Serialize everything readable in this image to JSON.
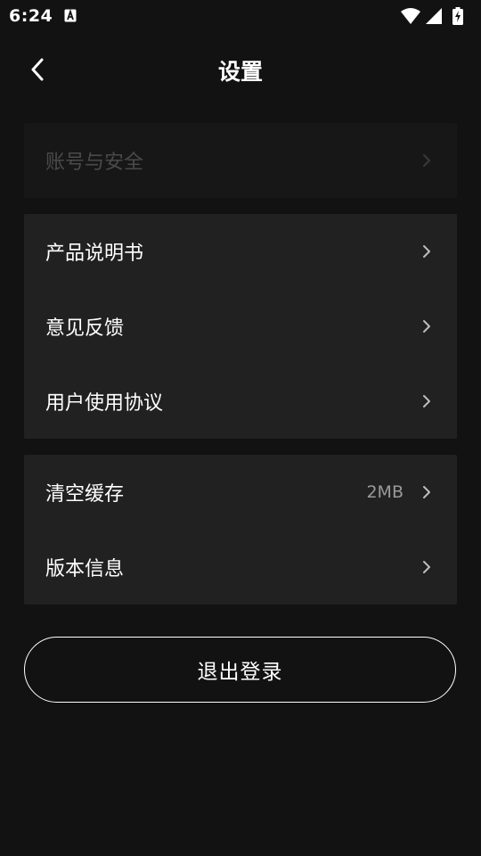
{
  "status_bar": {
    "time": "6:24",
    "icons": [
      "a-notification-icon",
      "wifi-icon",
      "signal-icon",
      "battery-charging-icon"
    ]
  },
  "header": {
    "title": "设置",
    "back_icon": "chevron-left-icon"
  },
  "groups": [
    {
      "items": [
        {
          "label": "账号与安全",
          "disabled": true
        }
      ]
    },
    {
      "items": [
        {
          "label": "产品说明书"
        },
        {
          "label": "意见反馈"
        },
        {
          "label": "用户使用协议"
        }
      ]
    },
    {
      "items": [
        {
          "label": "清空缓存",
          "value": "2MB"
        },
        {
          "label": "版本信息"
        }
      ]
    }
  ],
  "logout": {
    "label": "退出登录"
  },
  "colors": {
    "background": "#121212",
    "card": "#212121",
    "card_disabled": "#171717",
    "text": "#ffffff",
    "text_disabled": "#4a4a4a",
    "value": "#9a9a9a"
  }
}
